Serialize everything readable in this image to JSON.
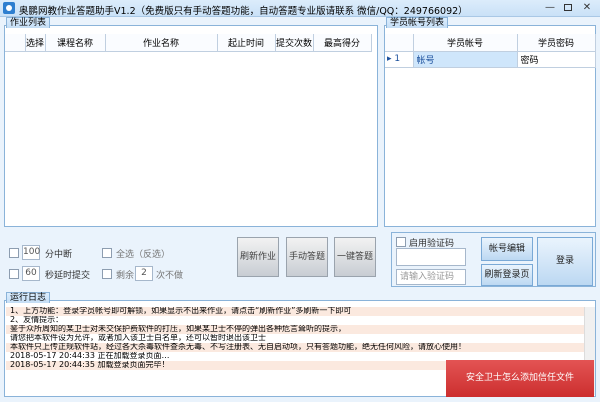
{
  "window": {
    "title": "奥鹏网教作业答题助手V1.2（免费版只有手动答题功能，自动答题专业版请联系 微信/QQ：249766092）",
    "min_label": "—",
    "close_label": "✕"
  },
  "homework": {
    "group_title": "作业列表",
    "columns": [
      "选择",
      "课程名称",
      "作业名称",
      "起止时间",
      "提交次数",
      "最高得分"
    ]
  },
  "accounts": {
    "group_title": "学员帐号列表",
    "columns": [
      "学员帐号",
      "学员密码"
    ],
    "rows": [
      {
        "index": "1",
        "account": "帐号",
        "password": "密码"
      }
    ]
  },
  "options": {
    "interval_value": "100",
    "interval_label": "分中断",
    "delay_value": "60",
    "delay_label": "秒延时提交",
    "select_all_label": "全选（反选）",
    "remaining_prefix": "剩余",
    "remaining_value": "2",
    "remaining_suffix": "次不做"
  },
  "buttons": {
    "refresh": "刷新作业",
    "manual": "手动答题",
    "one_click": "一键答题",
    "account_edit": "帐号编辑",
    "refresh_login": "刷新登录页",
    "login": "登录"
  },
  "captcha": {
    "enable_label": "启用验证码",
    "placeholder": "请输入验证码"
  },
  "log": {
    "group_title": "运行日志",
    "lines": [
      "1、上方功能：登录学员帐号即可解锁，如果显示不出来作业，请点击“刷新作业”多刷新一下即可",
      "2、友情提示：",
      "鉴于众所周知的某卫士对未交保护费软件的打压，如果某卫士不停的弹出各种危言耸听的提示，",
      "请您把本软件设为允许，或者加入该卫士白名单，还可以暂时退出该卫士",
      "本软件只上传正规软件站，经过各大杀毒软件查杀无毒、不写注册表、无自启动项，只有答题功能，绝无任何风险，请放心使用！",
      "2018-05-17 20:44:33        正在加载登录页面…",
      "2018-05-17 20:44:35        加载登录页面完毕！"
    ],
    "toast": "安全卫士怎么添加信任文件"
  }
}
